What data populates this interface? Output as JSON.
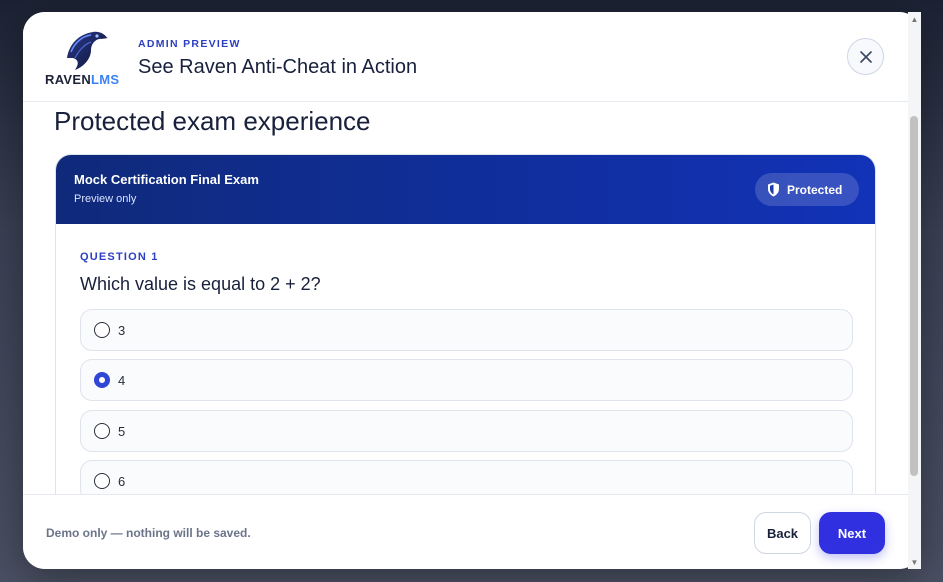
{
  "header": {
    "logo_text_main": "RAVEN",
    "logo_text_accent": "LMS",
    "eyebrow": "ADMIN PREVIEW",
    "title": "See Raven Anti-Cheat in Action",
    "close_icon": "close-icon"
  },
  "main": {
    "section_title": "Protected exam experience",
    "exam": {
      "name": "Mock Certification Final Exam",
      "subtitle": "Preview only",
      "badge_label": "Protected",
      "badge_icon": "shield-icon"
    },
    "question": {
      "label": "QUESTION 1",
      "text": "Which value is equal to 2 + 2?",
      "options": [
        {
          "label": "3",
          "selected": false
        },
        {
          "label": "4",
          "selected": true
        },
        {
          "label": "5",
          "selected": false
        },
        {
          "label": "6",
          "selected": false
        }
      ]
    }
  },
  "footer": {
    "note": "Demo only — nothing will be saved.",
    "back_label": "Back",
    "next_label": "Next"
  },
  "colors": {
    "accent": "#3030e0",
    "header_gradient_start": "#0f2a7a",
    "header_gradient_end": "#1232b8",
    "eyebrow": "#2c3fc0"
  }
}
